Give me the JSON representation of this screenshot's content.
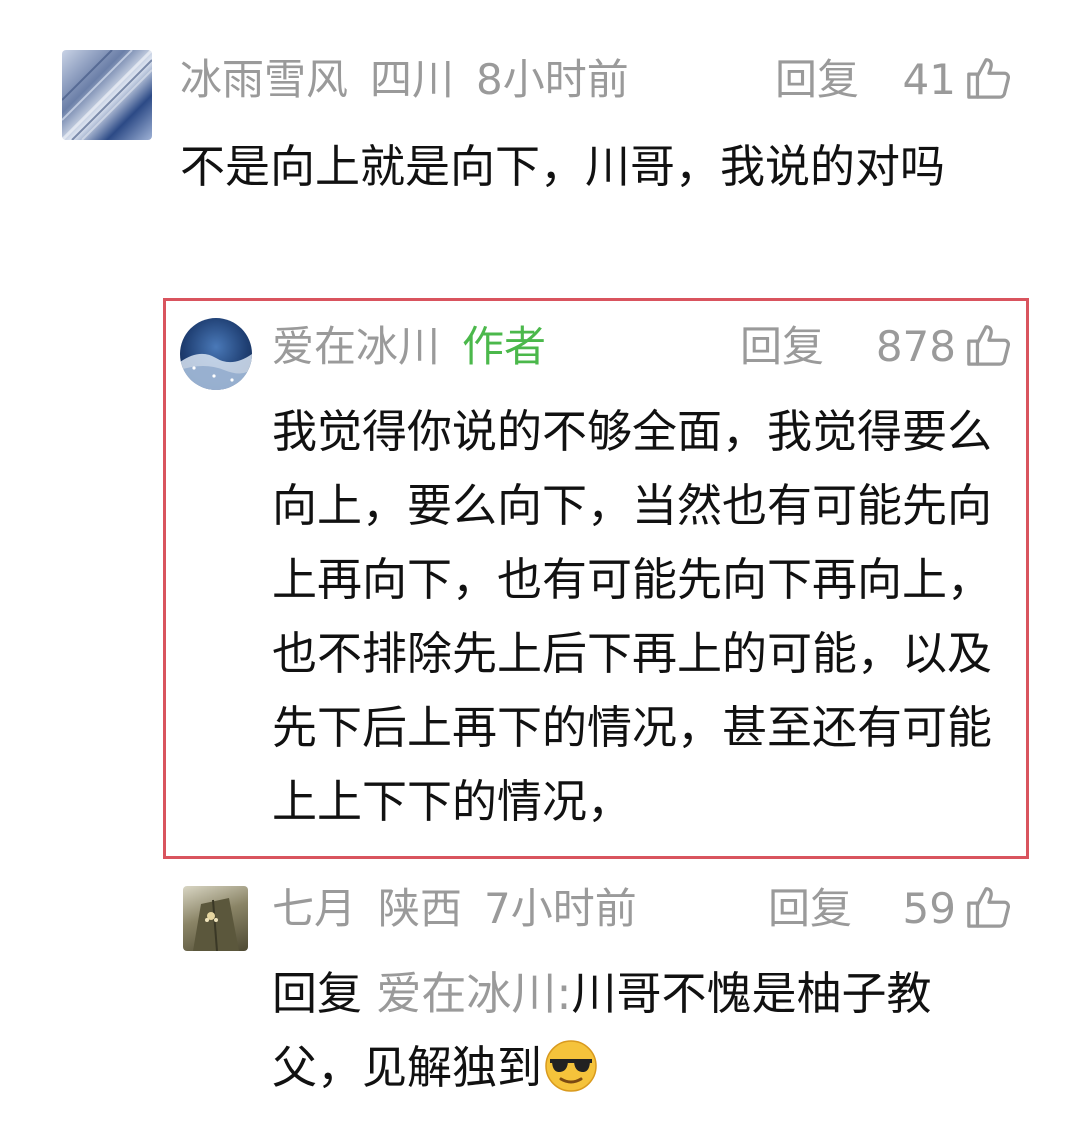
{
  "comments": [
    {
      "username": "冰雨雪风",
      "location": "四川",
      "time": "8小时前",
      "reply_label": "回复",
      "likes": "41",
      "text": "不是向上就是向下，川哥，我说的对吗"
    },
    {
      "username": "爱在冰川",
      "badge": "作者",
      "reply_label": "回复",
      "likes": "878",
      "text": "我觉得你说的不够全面，我觉得要么向上，要么向下，当然也有可能先向上再向下，也有可能先向下再向上，也不排除先上后下再上的可能，以及先下后上再下的情况，甚至还有可能上上下下的情况，"
    },
    {
      "username": "七月",
      "location": "陕西",
      "time": "7小时前",
      "reply_label": "回复",
      "likes": "59",
      "reply_prefix": "回复",
      "reply_to": "爱在冰川:",
      "text": "川哥不愧是柚子教父，见解独到",
      "emoji": "sunglasses-emoji"
    }
  ],
  "colors": {
    "meta_gray": "#9a9a9a",
    "author_green": "#4bb84b",
    "highlight_border": "#d9545e",
    "text": "#111111"
  },
  "icons": {
    "like": "thumbs-up-icon",
    "emoji": "sunglasses-emoji"
  }
}
